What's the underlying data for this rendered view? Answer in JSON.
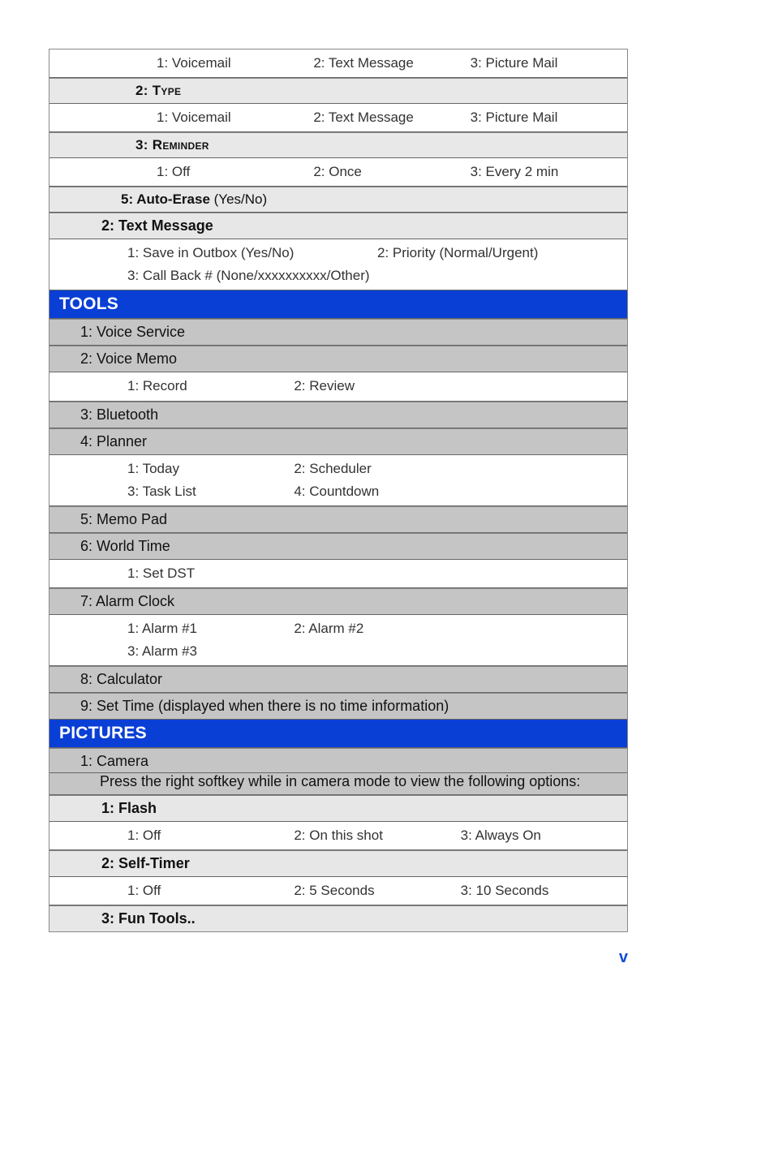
{
  "rows": {
    "r1": {
      "c1": "1: Voicemail",
      "c2": "2: Text Message",
      "c3": "3: Picture  Mail"
    },
    "type_hdr": "2: Type",
    "r2": {
      "c1": "1: Voicemail",
      "c2": "2: Text Message",
      "c3": "3: Picture  Mail"
    },
    "rem_hdr": "3: Reminder",
    "r3": {
      "c1": "1: Off",
      "c2": "2: Once",
      "c3": "3: Every 2 min"
    },
    "auto_erase": "5: Auto-Erase",
    "auto_erase_suffix": " (Yes/No)",
    "txtmsg": "2: Text Message",
    "r4": {
      "c1": "1: Save in Outbox (Yes/No)",
      "c2": "",
      "c3": "2: Priority (Normal/Urgent)"
    },
    "r4b": {
      "c1": "3: Call Back # (None/xxxxxxxxxx/Other)"
    },
    "tools": "TOOLS",
    "voice_service": "1: Voice Service",
    "voice_memo": "2: Voice Memo",
    "r5": {
      "c1": "1: Record",
      "c2": "2: Review",
      "c3": ""
    },
    "bluetooth": "3: Bluetooth",
    "planner": "4: Planner",
    "r6": {
      "c1": "1: Today",
      "c2": "2: Scheduler"
    },
    "r6b": {
      "c1": "3: Task List",
      "c2": "4: Countdown"
    },
    "memopad": "5: Memo Pad",
    "worldtime": "6: World Time",
    "r7": {
      "c1": "1: Set DST"
    },
    "alarmclock": "7: Alarm Clock",
    "r8": {
      "c1": "1: Alarm #1",
      "c2": "2: Alarm #2"
    },
    "r8b": {
      "c1": "3: Alarm #3"
    },
    "calculator": "8: Calculator",
    "settime": "9: Set Time (displayed when there is no time information)",
    "pictures": "PICTURES",
    "camera": "1: Camera",
    "camera_note": "Press the right softkey while in camera mode to view the following options:",
    "flash": "1: Flash",
    "r9": {
      "c1": "1: Off",
      "c2": "2: On this shot",
      "c3": "3: Always On"
    },
    "selftimer": "2: Self-Timer",
    "r10": {
      "c1": "1: Off",
      "c2": "2: 5 Seconds",
      "c3": "3: 10 Seconds"
    },
    "funtools": "3: Fun Tools.."
  },
  "page_number": "v"
}
